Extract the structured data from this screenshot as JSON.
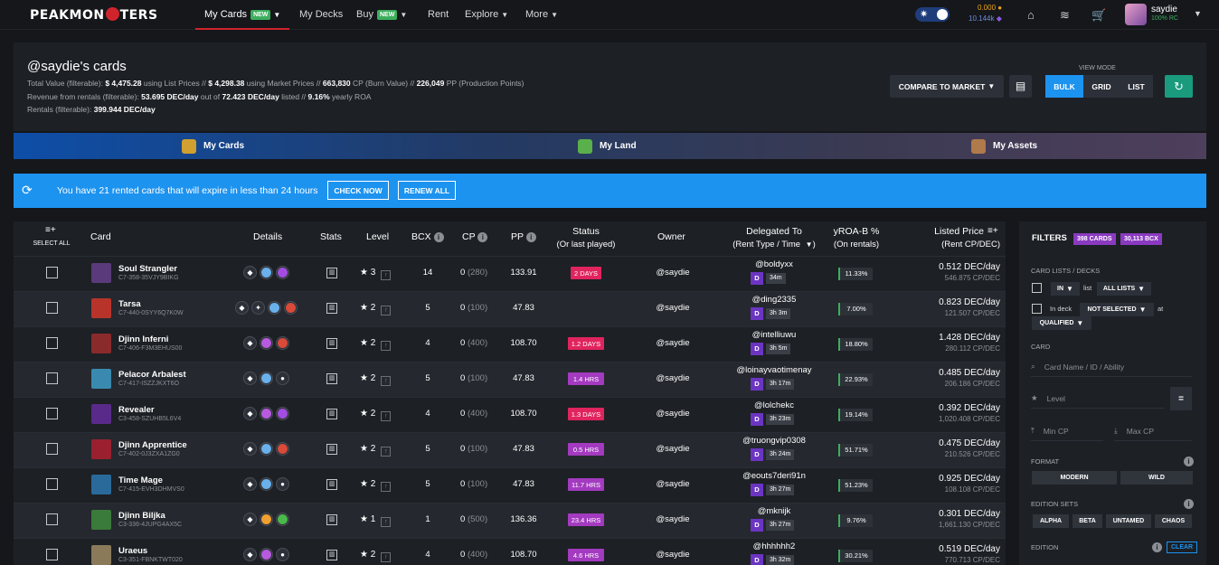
{
  "nav": {
    "logo": "PEAKMONSTERS",
    "items": [
      {
        "label": "My Cards",
        "badge": "NEW",
        "dropdown": true
      },
      {
        "label": "My Decks"
      },
      {
        "label": "Buy",
        "badge": "NEW",
        "dropdown": true
      },
      {
        "label": "Rent"
      },
      {
        "label": "Explore",
        "dropdown": true
      },
      {
        "label": "More",
        "dropdown": true
      }
    ],
    "balance_top": "0.000",
    "balance_bottom": "10.144k",
    "username": "saydie",
    "rc": "100% RC"
  },
  "header": {
    "title": "@saydie's cards",
    "line1_a": "Total Value (filterable):",
    "line1_b": "$ 4,475.28",
    "line1_c": "using List Prices //",
    "line1_d": "$ 4,298.38",
    "line1_e": "using Market Prices //",
    "line1_f": "663,830",
    "line1_g": "CP (Burn Value) //",
    "line1_h": "226,049",
    "line1_i": "PP (Production Points)",
    "line2_a": "Revenue from rentals (filterable):",
    "line2_b": "53.695 DEC/day",
    "line2_c": "out of",
    "line2_d": "72.423 DEC/day",
    "line2_e": "listed //",
    "line2_f": "9.16%",
    "line2_g": "yearly ROA",
    "line3_a": "Rentals (filterable):",
    "line3_b": "399.944 DEC/day",
    "compare_label": "COMPARE TO MARKET",
    "view_mode_label": "VIEW MODE",
    "view_modes": [
      "BULK",
      "GRID",
      "LIST"
    ],
    "active_view": "BULK"
  },
  "tabs": [
    "My Cards",
    "My Land",
    "My Assets"
  ],
  "banner": {
    "text": "You have 21 rented cards that will expire in less than 24 hours",
    "check_now": "CHECK NOW",
    "renew_all": "RENEW ALL"
  },
  "table": {
    "headers": {
      "select_all": "SELECT ALL",
      "card": "Card",
      "details": "Details",
      "stats": "Stats",
      "level": "Level",
      "bcx": "BCX",
      "cp": "CP",
      "pp": "PP",
      "status": "Status",
      "status_sub": "(Or last played)",
      "owner": "Owner",
      "delegated": "Delegated To",
      "delegated_sub": "(Rent Type / Time",
      "roa": "yROA-B %",
      "roa_sub": "(On rentals)",
      "price": "Listed Price",
      "price_sub": "(Rent CP/DEC)"
    },
    "rows": [
      {
        "name": "Soul Strangler",
        "id": "C7-358-35VJY9BIKG",
        "level": "3",
        "bcx": "14",
        "cp": "0",
        "cp_sub": "(280)",
        "pp": "133.91",
        "status": "2 DAYS",
        "status_color": "#e0245e",
        "owner": "@saydie",
        "deleg": "@boldyxx",
        "time": "34m",
        "roa": "11.33%",
        "price": "0.512 DEC/day",
        "price_cp": "546.875 CP/DEC",
        "thumb": "#5a3a7a",
        "icons": [
          "#2c3038",
          "#6ab0ea",
          "#a24de0"
        ]
      },
      {
        "name": "Tarsa",
        "id": "C7-440-0SYY6Q7K0W",
        "level": "2",
        "bcx": "5",
        "cp": "0",
        "cp_sub": "(100)",
        "pp": "47.83",
        "status": "",
        "status_color": "",
        "owner": "@saydie",
        "deleg": "@ding2335",
        "time": "3h 3m",
        "roa": "7.00%",
        "price": "0.823 DEC/day",
        "price_cp": "121.507 CP/DEC",
        "thumb": "#b8342a",
        "icons": [
          "#2c3038",
          "#2c3038",
          "#6ab0ea",
          "#d84a3a"
        ]
      },
      {
        "name": "Djinn Inferni",
        "id": "C7-406-F3M3EHUS00",
        "level": "2",
        "bcx": "4",
        "cp": "0",
        "cp_sub": "(400)",
        "pp": "108.70",
        "status": "1.2 DAYS",
        "status_color": "#e0245e",
        "owner": "@saydie",
        "deleg": "@intelliuwu",
        "time": "3h 5m",
        "roa": "18.80%",
        "price": "1.428 DEC/day",
        "price_cp": "280.112 CP/DEC",
        "thumb": "#8a2a2a",
        "icons": [
          "#2c3038",
          "#b85ae0",
          "#d84a3a"
        ]
      },
      {
        "name": "Pelacor Arbalest",
        "id": "C7-417-ISZZJKXT6O",
        "level": "2",
        "bcx": "5",
        "cp": "0",
        "cp_sub": "(100)",
        "pp": "47.83",
        "status": "1.4 HRS",
        "status_color": "#a33ac0",
        "owner": "@saydie",
        "deleg": "@loinayvaotimenay",
        "time": "3h 17m",
        "roa": "22.93%",
        "price": "0.485 DEC/day",
        "price_cp": "206.186 CP/DEC",
        "thumb": "#3a8ab0",
        "icons": [
          "#2c3038",
          "#6ab0ea",
          "#2c3038"
        ]
      },
      {
        "name": "Revealer",
        "id": "C3-458-SZUHB5L6V4",
        "level": "2",
        "bcx": "4",
        "cp": "0",
        "cp_sub": "(400)",
        "pp": "108.70",
        "status": "1.3 DAYS",
        "status_color": "#e0245e",
        "owner": "@saydie",
        "deleg": "@lolchekc",
        "time": "3h 23m",
        "roa": "19.14%",
        "price": "0.392 DEC/day",
        "price_cp": "1,020.408 CP/DEC",
        "thumb": "#5a2a8a",
        "icons": [
          "#2c3038",
          "#b85ae0",
          "#a24de0"
        ]
      },
      {
        "name": "Djinn Apprentice",
        "id": "C7-402-0J3ZXA1ZG0",
        "level": "2",
        "bcx": "5",
        "cp": "0",
        "cp_sub": "(100)",
        "pp": "47.83",
        "status": "0.5 HRS",
        "status_color": "#a33ac0",
        "owner": "@saydie",
        "deleg": "@truongvip0308",
        "time": "3h 24m",
        "roa": "51.71%",
        "price": "0.475 DEC/day",
        "price_cp": "210.526 CP/DEC",
        "thumb": "#9a2030",
        "icons": [
          "#2c3038",
          "#6ab0ea",
          "#d84a3a"
        ]
      },
      {
        "name": "Time Mage",
        "id": "C7-415-EVH3DHMVS0",
        "level": "2",
        "bcx": "5",
        "cp": "0",
        "cp_sub": "(100)",
        "pp": "47.83",
        "status": "11.7 HRS",
        "status_color": "#a33ac0",
        "owner": "@saydie",
        "deleg": "@eouts7deri91n",
        "time": "3h 27m",
        "roa": "51.23%",
        "price": "0.925 DEC/day",
        "price_cp": "108.108 CP/DEC",
        "thumb": "#2a6a9a",
        "icons": [
          "#2c3038",
          "#6ab0ea",
          "#2c3038"
        ]
      },
      {
        "name": "Djinn Biljka",
        "id": "C3-336-4JUPG4AX5C",
        "level": "1",
        "bcx": "1",
        "cp": "0",
        "cp_sub": "(500)",
        "pp": "136.36",
        "status": "23.4 HRS",
        "status_color": "#a33ac0",
        "owner": "@saydie",
        "deleg": "@mknijk",
        "time": "3h 27m",
        "roa": "9.76%",
        "price": "0.301 DEC/day",
        "price_cp": "1,661.130 CP/DEC",
        "thumb": "#3a7a3a",
        "icons": [
          "#2c3038",
          "#f0a030",
          "#4ab84a"
        ]
      },
      {
        "name": "Uraeus",
        "id": "C3-351-FBNKTWT020",
        "level": "2",
        "bcx": "4",
        "cp": "0",
        "cp_sub": "(400)",
        "pp": "108.70",
        "status": "4.6 HRS",
        "status_color": "#a33ac0",
        "owner": "@saydie",
        "deleg": "@hhhhhh2",
        "time": "3h 32m",
        "roa": "30.21%",
        "price": "0.519 DEC/day",
        "price_cp": "770.713 CP/DEC",
        "thumb": "#8a7a5a",
        "icons": [
          "#2c3038",
          "#b85ae0",
          "#2c3038"
        ]
      }
    ]
  },
  "filters": {
    "title": "FILTERS",
    "cards_badge": "398 CARDS",
    "bcx_badge": "30,113 BCX",
    "card_lists_label": "CARD LISTS / DECKS",
    "in_label": "IN",
    "list_label": "list",
    "all_lists": "ALL LISTS",
    "in_deck": "In deck",
    "not_selected": "NOT SELECTED",
    "at_label": "at",
    "qualified": "QUALIFIED",
    "card_label": "CARD",
    "search_placeholder": "Card Name / ID / Ability",
    "level_placeholder": "Level",
    "eq": "=",
    "min_cp": "Min CP",
    "max_cp": "Max CP",
    "format_label": "FORMAT",
    "formats": [
      "MODERN",
      "WILD"
    ],
    "edition_sets_label": "EDITION SETS",
    "edition_sets": [
      "ALPHA",
      "BETA",
      "UNTAMED",
      "CHAOS"
    ],
    "edition_label": "EDITION",
    "clear": "CLEAR"
  }
}
